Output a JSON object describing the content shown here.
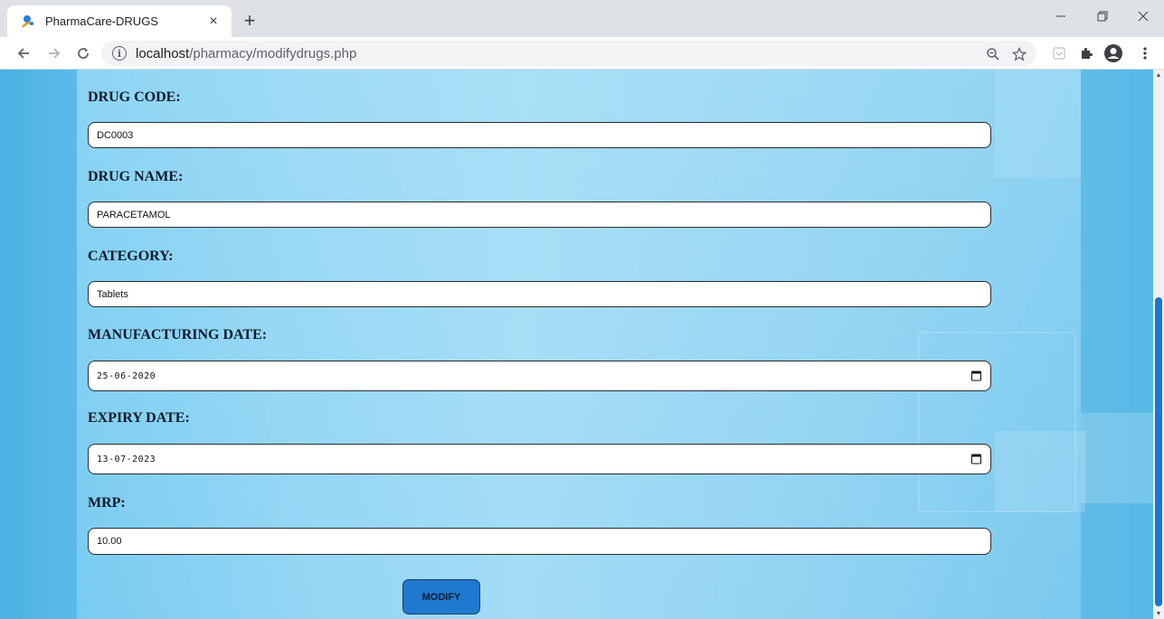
{
  "browser": {
    "tab_title": "PharmaCare-DRUGS",
    "tab_close": "×",
    "new_tab": "+",
    "url_host": "localhost",
    "url_path": "/pharmacy/modifydrugs.php",
    "icons": [
      "back-arrow-icon",
      "forward-arrow-icon",
      "reload-icon",
      "info-icon",
      "zoom-out-icon",
      "star-icon",
      "extension-icon",
      "puzzle-icon",
      "profile-icon",
      "menu-icon"
    ]
  },
  "form": {
    "drug_code": {
      "label": "DRUG CODE:",
      "value": "DC0003"
    },
    "drug_name": {
      "label": "DRUG NAME:",
      "value": "PARACETAMOL"
    },
    "category": {
      "label": "CATEGORY:",
      "value": "Tablets"
    },
    "mfg_date": {
      "label": "MANUFACTURING DATE:",
      "value": "25-06-2020"
    },
    "exp_date": {
      "label": "EXPIRY DATE:",
      "value": "13-07-2023"
    },
    "mrp": {
      "label": "MRP:",
      "value": "10.00"
    },
    "submit_label": "MODIFY"
  },
  "colors": {
    "accent": "#1f79cf",
    "scrollbar": "#1a76d2"
  }
}
